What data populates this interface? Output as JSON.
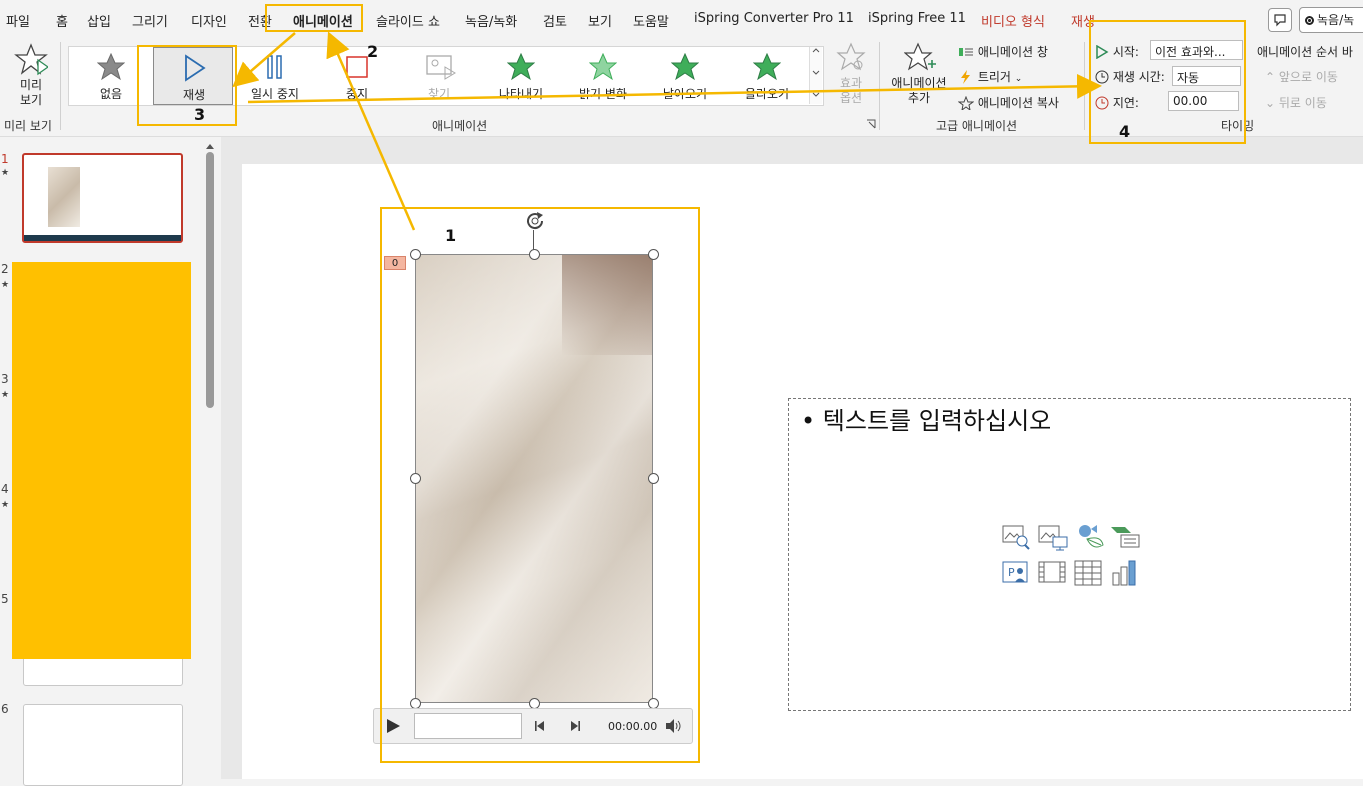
{
  "menu": {
    "tabs": [
      "파일",
      "홈",
      "삽입",
      "그리기",
      "디자인",
      "전환",
      "애니메이션",
      "슬라이드 쇼",
      "녹음/녹화",
      "검토",
      "보기",
      "도움말",
      "iSpring Converter Pro 11",
      "iSpring Free 11",
      "비디오 형식",
      "재생"
    ],
    "active_tab": "애니메이션",
    "record_button": "녹음/녹",
    "accent_color": "#c0392b"
  },
  "ribbon": {
    "preview": {
      "label": "미리 보기",
      "group": "미리 보기"
    },
    "gallery": {
      "items": [
        {
          "label": "없음",
          "icon": "star-gray-icon"
        },
        {
          "label": "재생",
          "icon": "play-icon",
          "selected": true
        },
        {
          "label": "일시 중지",
          "icon": "pause-icon"
        },
        {
          "label": "중지",
          "icon": "stop-icon"
        },
        {
          "label": "찾기",
          "icon": "seek-icon",
          "disabled": true
        },
        {
          "label": "나타내기",
          "icon": "star-green-icon"
        },
        {
          "label": "밝기 변화",
          "icon": "star-green-light-icon"
        },
        {
          "label": "날아오기",
          "icon": "star-green-icon"
        },
        {
          "label": "올라오기",
          "icon": "star-green-icon"
        }
      ],
      "group": "애니메이션"
    },
    "effect_options": {
      "label": "효과 옵션"
    },
    "advanced": {
      "add_animation": "애니메이션 추가",
      "animation_pane": "애니메이션 창",
      "trigger": "트리거",
      "painter": "애니메이션 복사",
      "group": "고급 애니메이션"
    },
    "timing": {
      "start_label": "시작:",
      "start_value": "이전 효과와...",
      "duration_label": "재생 시간:",
      "duration_value": "자동",
      "delay_label": "지연:",
      "delay_value": "00.00",
      "group": "타이밍",
      "reorder_label": "애니메이션 순서 바",
      "move_earlier": "앞으로 이동",
      "move_later": "뒤로 이동"
    }
  },
  "thumbnails": {
    "slide_numbers": [
      "1",
      "2",
      "3",
      "4",
      "5",
      "6"
    ]
  },
  "slide": {
    "placeholder_text": "텍스트를 입력하십시오",
    "animation_tag": "0",
    "video_time": "00:00.00"
  },
  "callouts": [
    "1",
    "2",
    "3",
    "4"
  ],
  "highlight_color": "#f5b800"
}
